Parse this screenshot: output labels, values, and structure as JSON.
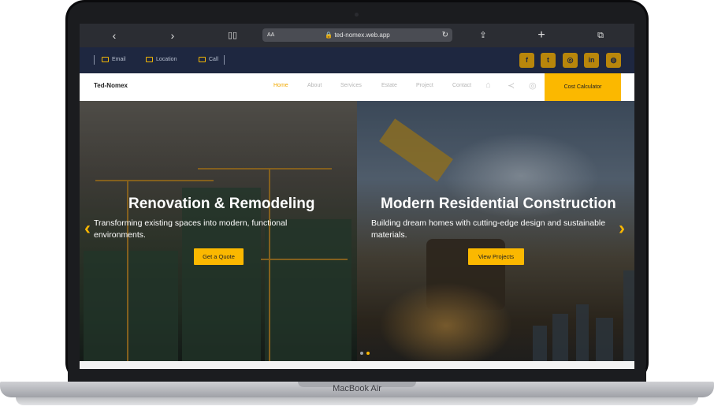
{
  "browser": {
    "back_icon": "chevron-left-icon",
    "forward_icon": "chevron-right-icon",
    "reader_icon": "book-icon",
    "text_size_label": "AA",
    "url": "ted-nomex.web.app",
    "reload_icon": "reload-icon",
    "share_icon": "share-icon",
    "new_tab_icon": "plus-icon",
    "tabs_icon": "tabs-icon"
  },
  "infobar": {
    "email_label": "Email",
    "location_label": "Location",
    "call_label": "Call",
    "socials": [
      {
        "name": "facebook",
        "glyph": "f"
      },
      {
        "name": "twitter",
        "glyph": "t"
      },
      {
        "name": "instagram",
        "glyph": "◎"
      },
      {
        "name": "linkedin",
        "glyph": "in"
      },
      {
        "name": "globe",
        "glyph": "◍"
      }
    ],
    "accent_color": "#f2b705"
  },
  "nav": {
    "logo": "Ted-Nomex",
    "links": [
      "Home",
      "About",
      "Services",
      "Estate",
      "Project",
      "Contact"
    ],
    "active": "Home",
    "cta_label": "Cost Calculator",
    "cta_color": "#fbb800"
  },
  "hero": {
    "slides": [
      {
        "title": "Renovation & Remodeling",
        "subtitle": "Transforming existing spaces into modern, functional environments.",
        "button": "Get a Quote"
      },
      {
        "title": "Modern Residential Construction",
        "subtitle": "Building dream homes with cutting-edge design and sustainable materials.",
        "button": "View Projects"
      }
    ],
    "prev_icon": "chevron-left-icon",
    "next_icon": "chevron-right-icon"
  },
  "device": {
    "label": "MacBook Air"
  }
}
